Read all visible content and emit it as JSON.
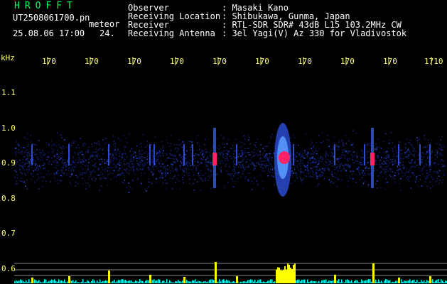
{
  "header": {
    "logo": "HROFFT",
    "file_name": "UT2508061700.pn",
    "kind": "meteor",
    "datetime": "25.08.06 17:00",
    "count": "24.",
    "observer_label": "Observer",
    "observer_value": ": Masaki Kano",
    "location_label": "Receiving Location",
    "location_value": ": Shibukawa, Gunma, Japan",
    "receiver_label": "Receiver",
    "receiver_value": ": RTL-SDR SDR# 43dB L15 103.2MHz CW",
    "antenna_label": "Receiving Antenna",
    "antenna_value": ": 3el Yagi(V) Az 330 for Vladivostok"
  },
  "axes": {
    "y_unit": "kHz",
    "y_ticks": [
      "1.1",
      "1.0",
      "0.9",
      "0.8",
      "0.7",
      "0.6"
    ],
    "x_ticks": [
      "170",
      "170",
      "170",
      "170",
      "170",
      "170",
      "170",
      "170",
      "170",
      "1710"
    ]
  },
  "colors": {
    "background": "#000000",
    "text": "#ffffff",
    "axis_text": "#ffff66",
    "logo": "#00ff66",
    "echo_core": "#ff2266",
    "noise_band": "#1a2a9a",
    "counter_bars": "#ffff00",
    "counter_baseline": "#00ffff"
  }
}
